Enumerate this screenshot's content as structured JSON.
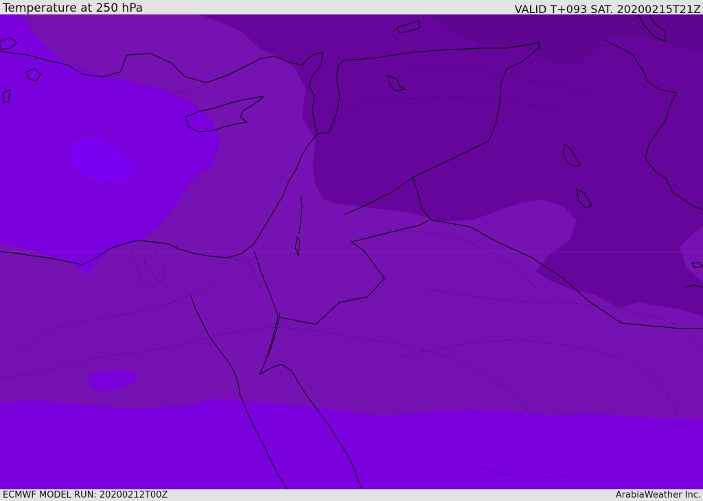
{
  "header": {
    "title": "Temperature at 250 hPa",
    "valid_time": "VALID T+093 SAT. 20200215T21Z"
  },
  "footer": {
    "model_run": "ECMWF MODEL RUN: 20200212T00Z",
    "credit": "ArabiaWeather Inc."
  },
  "colors": {
    "warmest_band": "#7b00de",
    "warm_pocket": "#7a00f4",
    "mid_band": "#7712b2",
    "cool_band": "#66059b",
    "coldest_band": "#5f0690",
    "coastline": "#000000",
    "header_background": "#e3e3e3"
  }
}
